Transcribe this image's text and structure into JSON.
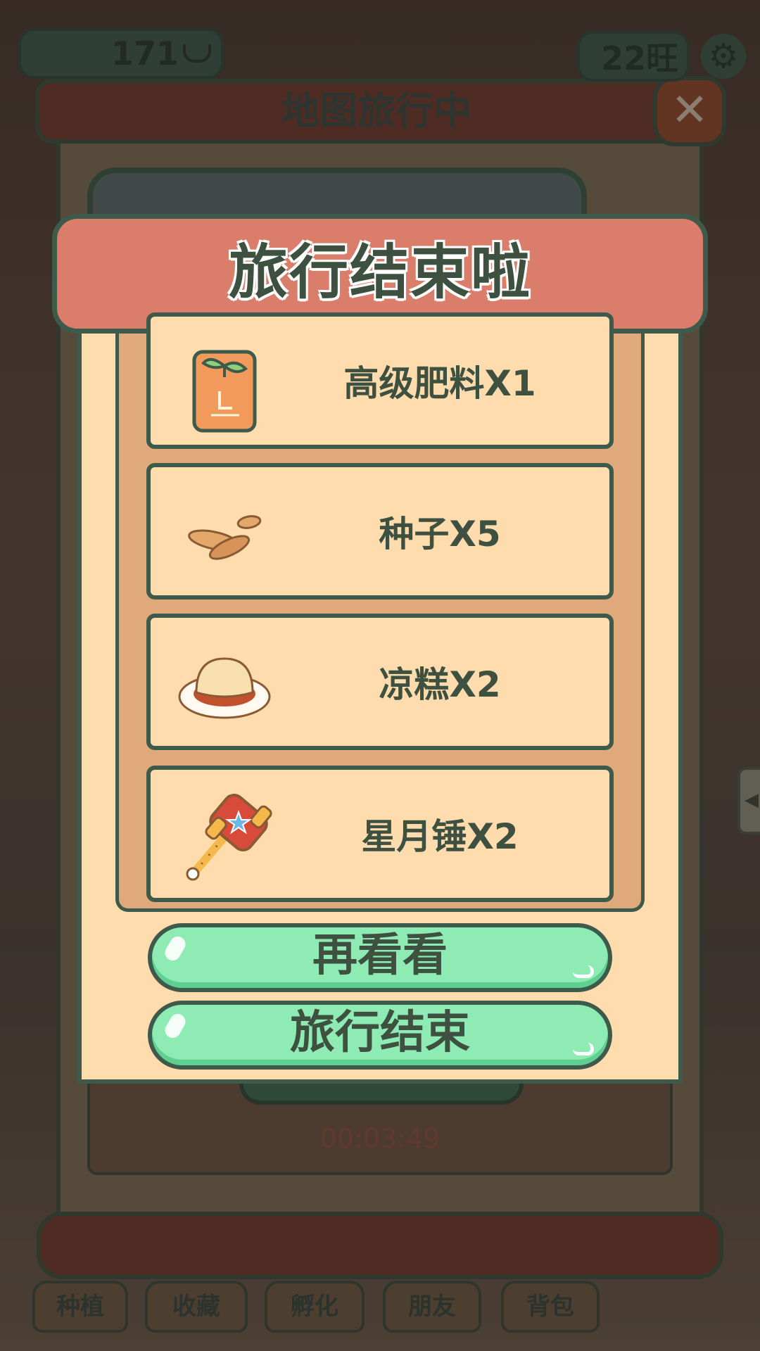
{
  "hud": {
    "coins": "171",
    "coin_icon": "ingot-icon",
    "wang": "22旺",
    "settings_icon": "gear-icon"
  },
  "travel_window": {
    "title": "地图旅行中",
    "close_icon": "close-icon",
    "timer": "00:03:49"
  },
  "modal": {
    "title": "旅行结束啦",
    "rewards": [
      {
        "label": "高级肥料X1",
        "icon": "fertilizer-bag-icon"
      },
      {
        "label": "种子X5",
        "icon": "seeds-icon"
      },
      {
        "label": "凉糕X2",
        "icon": "cool-cake-icon"
      },
      {
        "label": "星月锤X2",
        "icon": "star-moon-hammer-icon"
      }
    ],
    "look_again_button": "再看看",
    "end_travel_button": "旅行结束"
  },
  "bottom_nav": [
    {
      "label": "种植"
    },
    {
      "label": "收藏"
    },
    {
      "label": "孵化"
    },
    {
      "label": "朋友"
    },
    {
      "label": "背包"
    }
  ],
  "colors": {
    "modal_bg": "#fedcad",
    "header_bg": "#db7d6b",
    "button_green": "#8debb3",
    "outline": "#3e5a4a"
  }
}
